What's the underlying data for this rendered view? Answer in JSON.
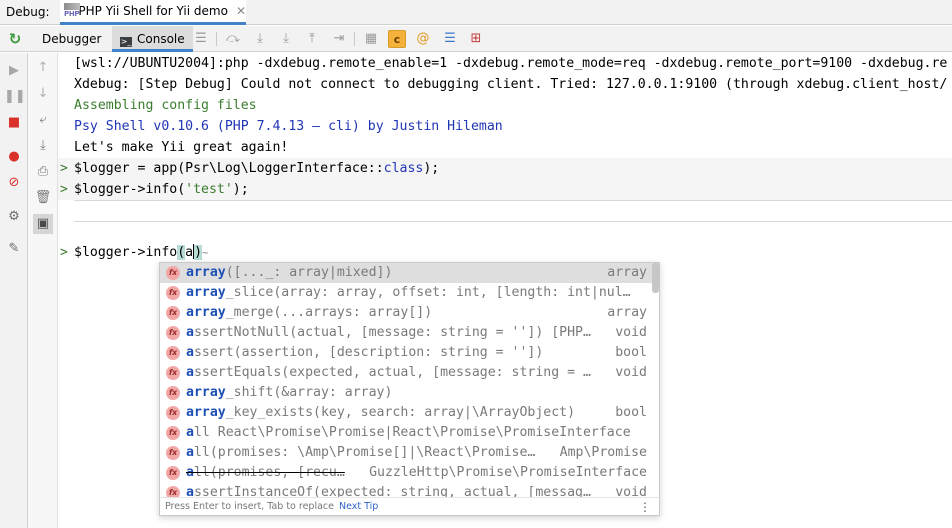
{
  "topbar": {
    "label": "Debug:",
    "session_tab": {
      "title": "PHP Yii Shell for Yii demo",
      "icon_text": "PHP",
      "close": "✕"
    }
  },
  "toolbar": {
    "debugger_tab": "Debugger",
    "console_tab": "Console",
    "icons": [
      "rerun-icon",
      "menu-icon",
      "step-over-icon",
      "step-into-icon",
      "force-step-into-icon",
      "step-out-icon",
      "run-to-cursor-icon",
      "evaluate-icon",
      "coverage-icon",
      "at-icon",
      "list-icon",
      "add-watch-icon"
    ],
    "c_icon_text": "c",
    "at_icon_text": "@"
  },
  "console": {
    "lines": [
      {
        "text": "[wsl://UBUNTU2004]:php -dxdebug.remote_enable=1 -dxdebug.remote_mode=req -dxdebug.remote_port=9100 -dxdebug.re",
        "style": "c-black"
      },
      {
        "text": "Xdebug: [Step Debug] Could not connect to debugging client. Tried: 127.0.0.1:9100 (through xdebug.client_host/",
        "style": "c-black"
      },
      {
        "text": "Assembling config files",
        "style": "c-green"
      },
      {
        "text": "Psy Shell v0.10.6 (PHP 7.4.13 — cli) by Justin Hileman",
        "style": "c-blue"
      },
      {
        "text": "Let's make Yii great again!",
        "style": "c-black"
      }
    ],
    "history": [
      {
        "prompt": ">",
        "pre": "$logger = app(Psr\\Log\\LoggerInterface::",
        "keyword": "class",
        "post": ");"
      },
      {
        "prompt": ">",
        "pre": "$logger->info(",
        "string": "'test'",
        "post": ");"
      }
    ],
    "input": {
      "prompt": ">",
      "pre": "$logger->info",
      "open_paren": "(",
      "typed": "a",
      "close_paren": ")"
    }
  },
  "completion": {
    "items": [
      {
        "bold": "array",
        "rest": "([..._: array|mixed])",
        "type": "array",
        "selected": true,
        "deprecated": false
      },
      {
        "bold": "array",
        "rest": "_slice(array: array, offset: int, [length: int|nul…",
        "type": "",
        "selected": false,
        "deprecated": false
      },
      {
        "bold": "array",
        "rest": "_merge(...arrays: array[])",
        "type": "array",
        "selected": false,
        "deprecated": false
      },
      {
        "bold": "a",
        "rest": "ssertNotNull(actual, [message: string = '']) [PHP…",
        "type": "void",
        "selected": false,
        "deprecated": false
      },
      {
        "bold": "a",
        "rest": "ssert(assertion, [description: string = ''])",
        "type": "bool",
        "selected": false,
        "deprecated": false
      },
      {
        "bold": "a",
        "rest": "ssertEquals(expected, actual, [message: string = …",
        "type": "void",
        "selected": false,
        "deprecated": false
      },
      {
        "bold": "array",
        "rest": "_shift(&array: array)",
        "type": "",
        "selected": false,
        "deprecated": false
      },
      {
        "bold": "array",
        "rest": "_key_exists(key, search: array|\\ArrayObject)",
        "type": "bool",
        "selected": false,
        "deprecated": false
      },
      {
        "bold": "a",
        "rest": "ll   React\\Promise\\Promise|React\\Promise\\PromiseInterface",
        "type": "",
        "selected": false,
        "deprecated": false
      },
      {
        "bold": "a",
        "rest": "ll(promises: \\Amp\\Promise[]|\\React\\Promise…",
        "type": "Amp\\Promise",
        "selected": false,
        "deprecated": false
      },
      {
        "bold": "a",
        "rest": "ll(promises, [recu…",
        "type": "GuzzleHttp\\Promise\\PromiseInterface",
        "selected": false,
        "deprecated": true
      },
      {
        "bold": "a",
        "rest": "ssertInstanceOf(expected: string, actual, [messag…",
        "type": "void",
        "selected": false,
        "deprecated": false
      }
    ],
    "footer": {
      "hint": "Press Enter to insert, Tab to replace",
      "tip": "Next Tip",
      "menu": "⋮"
    }
  },
  "colors": {
    "accent": "#4083c9",
    "green": "#3b7d2e",
    "blue": "#2135b7",
    "fx_badge": "#f2a7a7"
  }
}
